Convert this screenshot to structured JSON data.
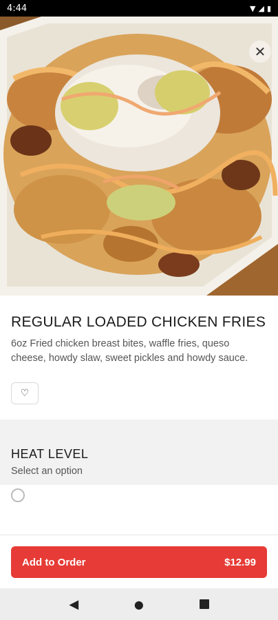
{
  "status_bar": {
    "time": "4:44",
    "wifi_icon": "wifi-icon",
    "signal_icon": "signal-icon",
    "battery_icon": "battery-icon"
  },
  "hero": {
    "image_name": "food-photo",
    "close_icon": "✕"
  },
  "item": {
    "title": "REGULAR LOADED CHICKEN FRIES",
    "description": "6oz Fried chicken breast bites, waffle fries, queso cheese, howdy slaw, sweet pickles and howdy sauce.",
    "favorite_icon": "♡"
  },
  "heat_level": {
    "title": "HEAT LEVEL",
    "subtitle": "Select an option"
  },
  "order": {
    "button_label": "Add to Order",
    "price": "$12.99",
    "accent_color": "#e63b36"
  },
  "nav": {
    "back": "◀",
    "home": "●"
  }
}
